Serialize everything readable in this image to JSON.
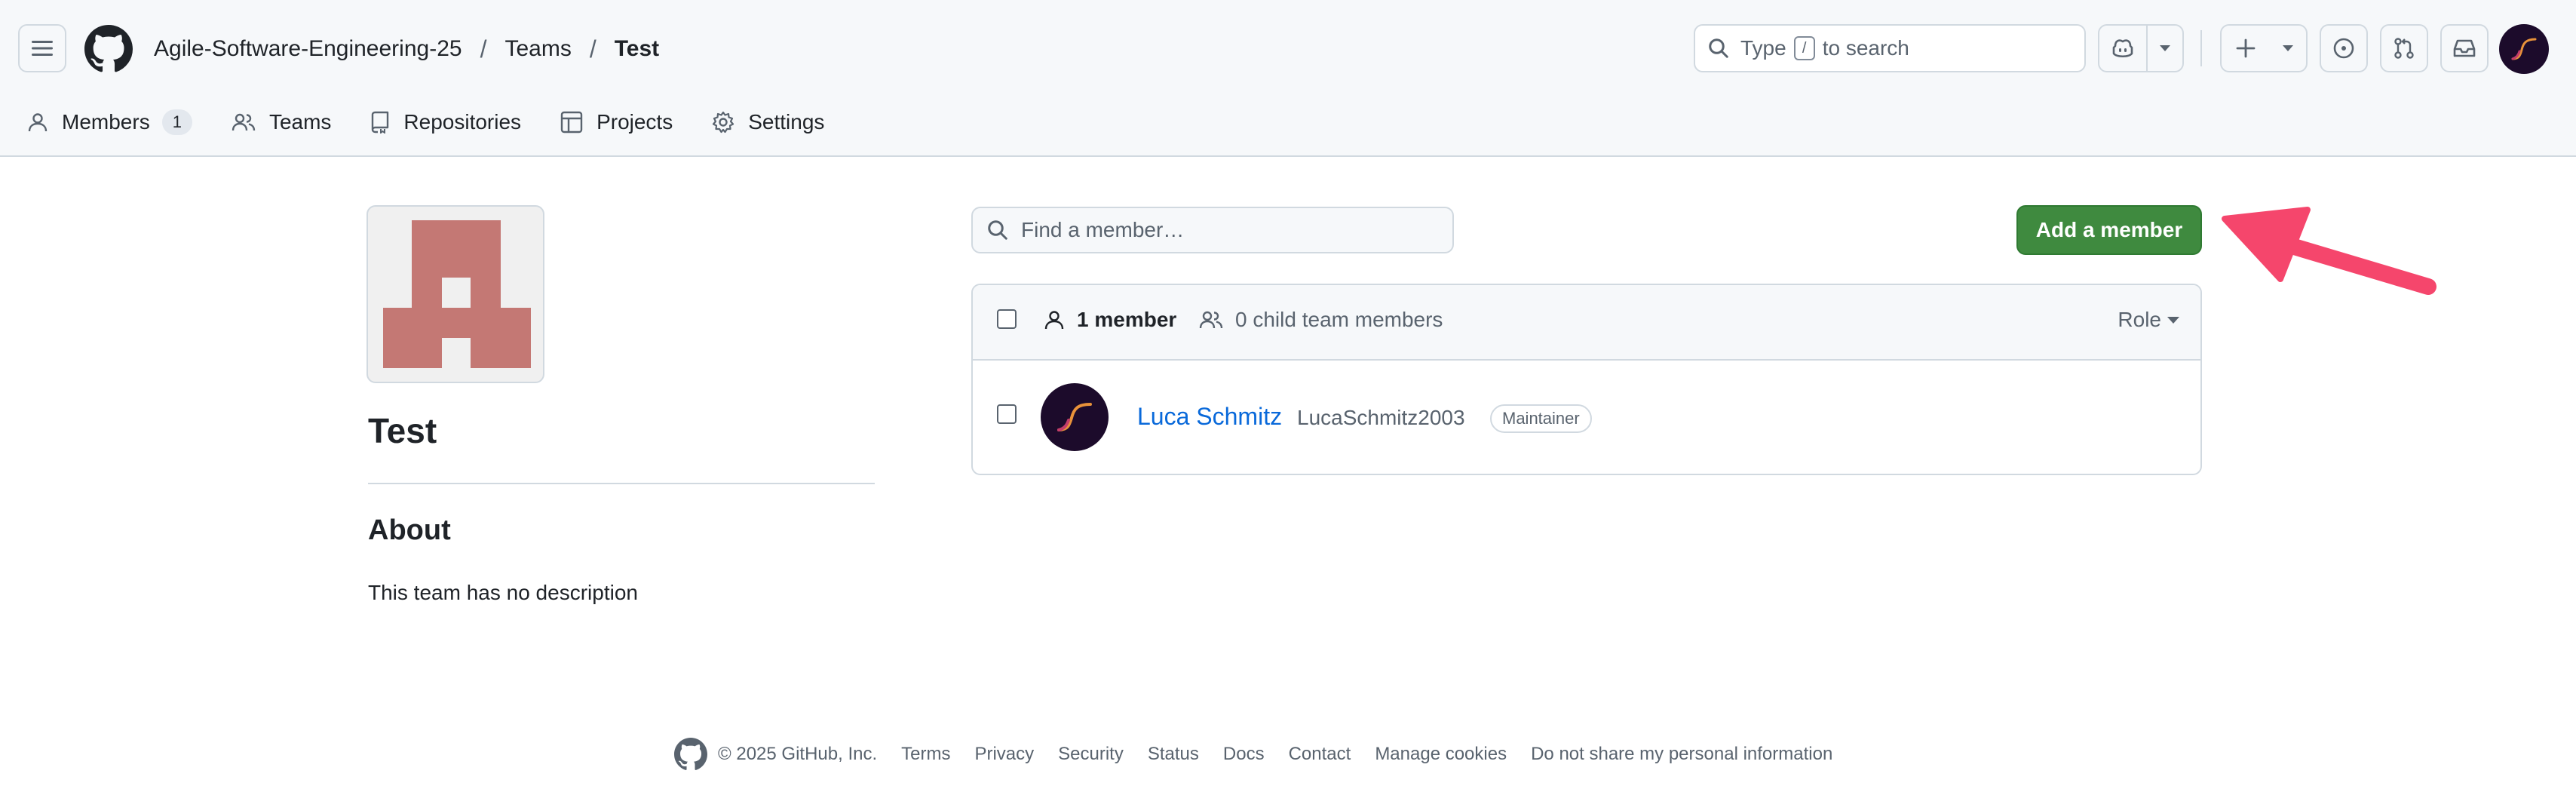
{
  "header": {
    "breadcrumb": [
      "Agile-Software-Engineering-25",
      "Teams",
      "Test"
    ],
    "separator": "/",
    "search": {
      "prefix": "Type",
      "key": "/",
      "suffix": "to search"
    }
  },
  "tabs": [
    {
      "label": "Members",
      "count": "1",
      "icon": "person-icon"
    },
    {
      "label": "Teams",
      "icon": "people-icon"
    },
    {
      "label": "Repositories",
      "icon": "repo-icon"
    },
    {
      "label": "Projects",
      "icon": "table-icon"
    },
    {
      "label": "Settings",
      "icon": "gear-icon"
    }
  ],
  "team": {
    "name": "Test",
    "about_title": "About",
    "description": "This team has no description",
    "avatar_color": "#c47874"
  },
  "members": {
    "search_placeholder": "Find a member…",
    "add_button": "Add a member",
    "member_count": "1 member",
    "child_count": "0 child team members",
    "role_label": "Role",
    "list": [
      {
        "name": "Luca Schmitz",
        "login": "LucaSchmitz2003",
        "role": "Maintainer"
      }
    ]
  },
  "annotation": {
    "arrow_color": "#f5466c"
  },
  "footer": {
    "copyright": "© 2025 GitHub, Inc.",
    "links": [
      "Terms",
      "Privacy",
      "Security",
      "Status",
      "Docs",
      "Contact",
      "Manage cookies",
      "Do not share my personal information"
    ]
  },
  "colors": {
    "accent_green": "#3f8a3f",
    "link_blue": "#0969da"
  }
}
